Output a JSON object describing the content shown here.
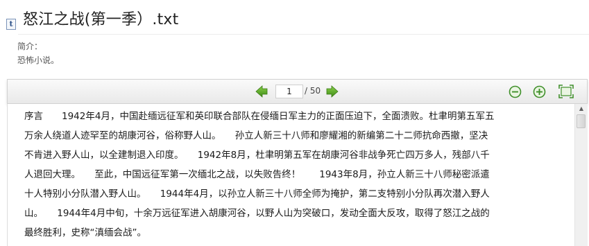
{
  "document": {
    "title": "怒江之战(第一季）.txt",
    "file_icon_glyph": "t",
    "intro_label": "简介：",
    "intro_text": "恐怖小说。"
  },
  "toolbar": {
    "current_page": "1",
    "total_pages": "/ 50",
    "prev_icon": "arrow-left-icon",
    "next_icon": "arrow-right-icon",
    "zoom_out_icon": "zoom-out-icon",
    "zoom_in_icon": "zoom-in-icon",
    "fit_icon": "fit-screen-icon"
  },
  "content": {
    "text": "序言　　1942年4月，中国赴缅远征军和英印联合部队在侵缅日军主力的正面压迫下，全面溃败。杜聿明第五军五万余人绕道人迹罕至的胡康河谷，俗称野人山。　　孙立人新三十八师和廖耀湘的新编第二十二师抗命西撤，坚决不肯进入野人山，以全建制退入印度。　　1942年8月，杜聿明第五军在胡康河谷非战争死亡四万多人，残部八千人退回大理。　　至此，中国远征军第一次缅北之战，以失败告终！　　1943年8月，孙立人新三十八师秘密派遣十人特别小分队潜入野人山。　　1944年4月，以孙立人新三十八师全师为掩护，第二支特别小分队再次潜入野人山。　　1944年4月中旬，十余万远征军进入胡康河谷，以野人山为突破口，发动全面大反攻，取得了怒江之战的最终胜利，史称“滇缅会战”。"
  },
  "colors": {
    "arrow_green": "#4f9a1e",
    "zoom_green": "#3f8f2a",
    "toolbar_top": "#fafafa",
    "toolbar_bottom": "#e9e9e9"
  }
}
